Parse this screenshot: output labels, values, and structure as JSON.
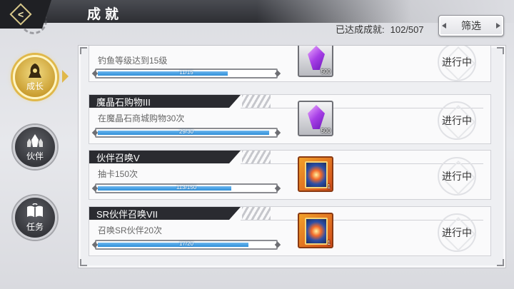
{
  "header": {
    "title": "成就",
    "progress_label": "已达成成就:",
    "progress_value": "102/507",
    "filter_label": "筛选"
  },
  "tabs": [
    {
      "label": "成长",
      "icon": "hooded-figure-icon",
      "active": true
    },
    {
      "label": "伙伴",
      "icon": "companions-icon",
      "active": false
    },
    {
      "label": "任务",
      "icon": "open-book-icon",
      "active": false
    }
  ],
  "achievements": [
    {
      "title": "",
      "desc": "钓鱼等级达到15级",
      "progress": "11/15",
      "fraction": 0.733,
      "reward_type": "crystal",
      "reward_qty": "500",
      "status": "进行中"
    },
    {
      "title": "魔晶石购物III",
      "desc": "在魔晶石商城购物30次",
      "progress": "29/30",
      "fraction": 0.967,
      "reward_type": "crystal",
      "reward_qty": "500",
      "status": "进行中"
    },
    {
      "title": "伙伴召唤V",
      "desc": "抽卡150次",
      "progress": "113/150",
      "fraction": 0.753,
      "reward_type": "card",
      "reward_qty": "1",
      "status": "进行中"
    },
    {
      "title": "SR伙伴召唤VII",
      "desc": "召唤SR伙伴20次",
      "progress": "17/20",
      "fraction": 0.85,
      "reward_type": "card",
      "reward_qty": "1",
      "status": "进行中"
    }
  ],
  "colors": {
    "bar_fill": "#2f8fd8",
    "active_tab": "#e0b84a",
    "title_bar": "#2a2b30"
  }
}
